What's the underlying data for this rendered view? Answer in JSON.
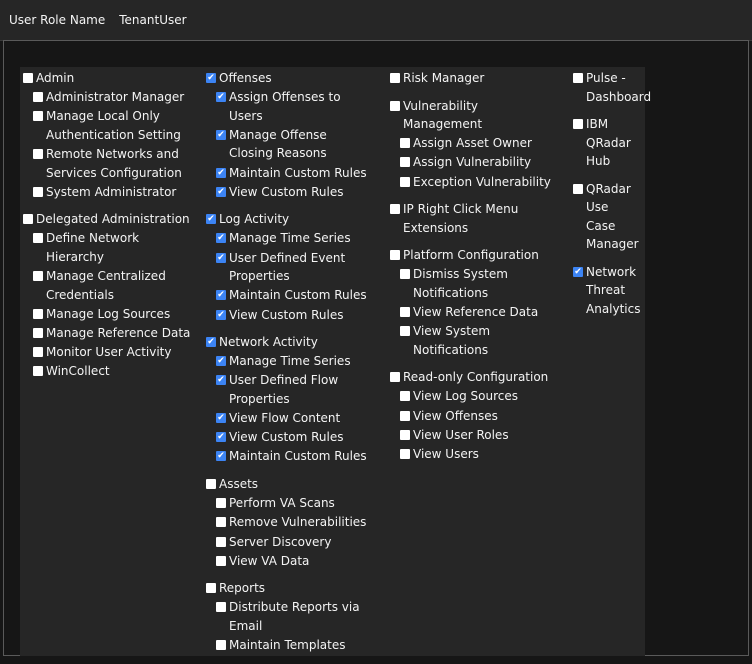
{
  "header": {
    "label": "User Role Name",
    "value": "TenantUser"
  },
  "columns": [
    [
      {
        "label": "Admin",
        "checked": false,
        "children": [
          {
            "label": "Administrator Manager",
            "checked": false
          },
          {
            "label": "Manage Local Only Authentication Setting",
            "checked": false
          },
          {
            "label": "Remote Networks and Services Configuration",
            "checked": false
          },
          {
            "label": "System Administrator",
            "checked": false
          }
        ]
      },
      {
        "label": "Delegated Administration",
        "checked": false,
        "children": [
          {
            "label": "Define Network Hierarchy",
            "checked": false
          },
          {
            "label": "Manage Centralized Credentials",
            "checked": false
          },
          {
            "label": "Manage Log Sources",
            "checked": false
          },
          {
            "label": "Manage Reference Data",
            "checked": false
          },
          {
            "label": "Monitor User Activity",
            "checked": false
          },
          {
            "label": "WinCollect",
            "checked": false
          }
        ]
      }
    ],
    [
      {
        "label": "Offenses",
        "checked": true,
        "children": [
          {
            "label": "Assign Offenses to Users",
            "checked": true
          },
          {
            "label": "Manage Offense Closing Reasons",
            "checked": true
          },
          {
            "label": "Maintain Custom Rules",
            "checked": true
          },
          {
            "label": "View Custom Rules",
            "checked": true
          }
        ]
      },
      {
        "label": "Log Activity",
        "checked": true,
        "children": [
          {
            "label": "Manage Time Series",
            "checked": true
          },
          {
            "label": "User Defined Event Properties",
            "checked": true
          },
          {
            "label": "Maintain Custom Rules",
            "checked": true
          },
          {
            "label": "View Custom Rules",
            "checked": true
          }
        ]
      },
      {
        "label": "Network Activity",
        "checked": true,
        "children": [
          {
            "label": "Manage Time Series",
            "checked": true
          },
          {
            "label": "User Defined Flow Properties",
            "checked": true
          },
          {
            "label": "View Flow Content",
            "checked": true
          },
          {
            "label": "View Custom Rules",
            "checked": true
          },
          {
            "label": "Maintain Custom Rules",
            "checked": true
          }
        ]
      },
      {
        "label": "Assets",
        "checked": false,
        "children": [
          {
            "label": "Perform VA Scans",
            "checked": false
          },
          {
            "label": "Remove Vulnerabilities",
            "checked": false
          },
          {
            "label": "Server Discovery",
            "checked": false
          },
          {
            "label": "View VA Data",
            "checked": false
          }
        ]
      },
      {
        "label": "Reports",
        "checked": false,
        "children": [
          {
            "label": "Distribute Reports via Email",
            "checked": false
          },
          {
            "label": "Maintain Templates",
            "checked": false
          }
        ]
      }
    ],
    [
      {
        "label": "Risk Manager",
        "checked": false,
        "children": []
      },
      {
        "label": "Vulnerability Management",
        "checked": false,
        "children": [
          {
            "label": "Assign Asset Owner",
            "checked": false
          },
          {
            "label": "Assign Vulnerability",
            "checked": false
          },
          {
            "label": "Exception Vulnerability",
            "checked": false
          }
        ]
      },
      {
        "label": "IP Right Click Menu Extensions",
        "checked": false,
        "children": []
      },
      {
        "label": "Platform Configuration",
        "checked": false,
        "children": [
          {
            "label": "Dismiss System Notifications",
            "checked": false
          },
          {
            "label": "View Reference Data",
            "checked": false
          },
          {
            "label": "View System Notifications",
            "checked": false
          }
        ]
      },
      {
        "label": "Read-only Configuration",
        "checked": false,
        "children": [
          {
            "label": "View Log Sources",
            "checked": false
          },
          {
            "label": "View Offenses",
            "checked": false
          },
          {
            "label": "View User Roles",
            "checked": false
          },
          {
            "label": "View Users",
            "checked": false
          }
        ]
      }
    ],
    [
      {
        "label": "Pulse - Dashboard",
        "checked": false,
        "children": []
      },
      {
        "label": "IBM QRadar Hub",
        "checked": false,
        "children": []
      },
      {
        "label": "QRadar Use Case Manager",
        "checked": false,
        "children": []
      },
      {
        "label": "Network Threat Analytics",
        "checked": true,
        "children": []
      }
    ]
  ],
  "colors": {
    "checked": "#3c84f4",
    "unchecked": "#ffffff",
    "panel": "#262626"
  }
}
